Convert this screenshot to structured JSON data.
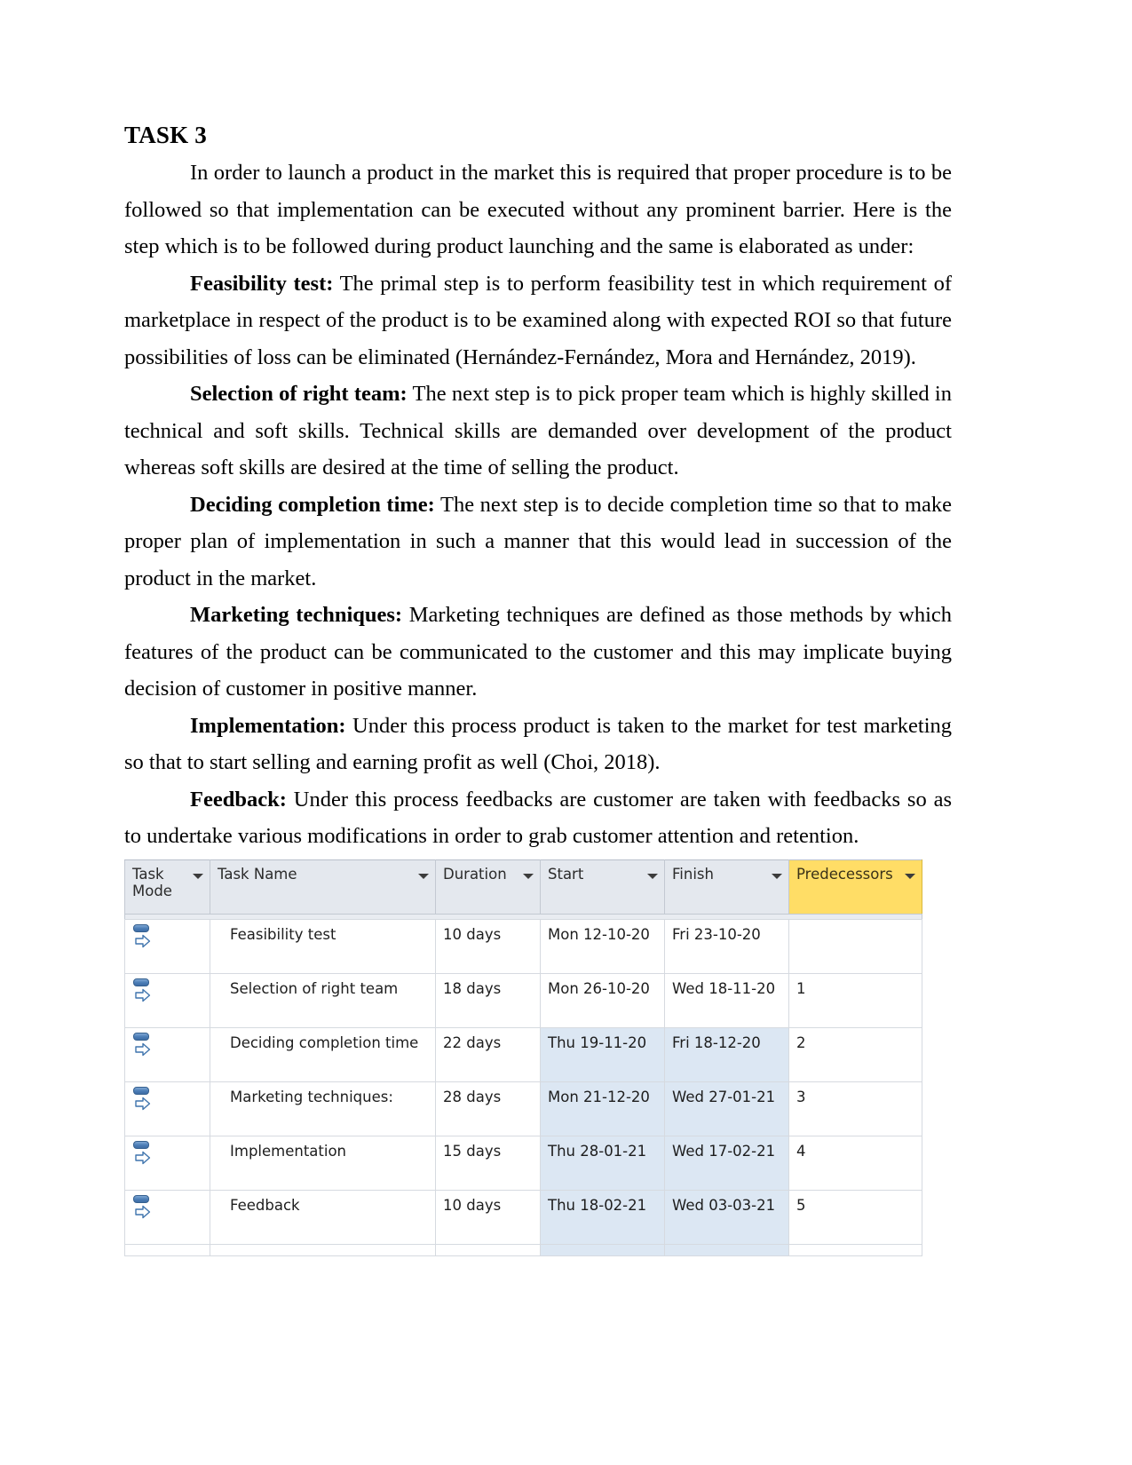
{
  "document": {
    "title": "TASK 3",
    "paragraphs": [
      {
        "lead": "",
        "text": "In order to launch a product in the market this is required that proper procedure is to be followed so that implementation can be executed without any prominent barrier. Here is the step which is to be followed during product launching and the same is elaborated as under:"
      },
      {
        "lead": "Feasibility test:",
        "text": " The primal step is to perform feasibility test in which requirement of marketplace in respect of the product is to be examined along with expected ROI so that future possibilities of loss can be eliminated (Hernández-Fernández, Mora and Hernández, 2019)."
      },
      {
        "lead": "Selection of right team:",
        "text": " The next step is to pick proper team which is highly skilled in technical and soft skills. Technical skills are demanded over development of the product whereas soft skills are desired at the time of selling the product."
      },
      {
        "lead": "Deciding completion time:",
        "text": " The next step is to decide completion time so that to make proper plan of implementation in such a manner that this would lead in succession of the product in the market."
      },
      {
        "lead": "Marketing techniques:",
        "text": " Marketing techniques are defined as those methods by which features of the product can be communicated to the customer and this may implicate buying decision of customer in positive manner."
      },
      {
        "lead": "Implementation:",
        "text": " Under this process product is taken to the market for test marketing so that to start selling and earning profit as well (Choi, 2018)."
      },
      {
        "lead": "Feedback:",
        "text": " Under this process feedbacks are customer are taken with feedbacks so as to undertake various modifications in order to grab customer attention and retention."
      }
    ]
  },
  "project_table": {
    "columns": [
      {
        "label": "Task Mode",
        "has_filter": true,
        "highlight": false
      },
      {
        "label": "Task Name",
        "has_filter": true,
        "highlight": false
      },
      {
        "label": "Duration",
        "has_filter": true,
        "highlight": false
      },
      {
        "label": "Start",
        "has_filter": true,
        "highlight": false
      },
      {
        "label": "Finish",
        "has_filter": true,
        "highlight": false
      },
      {
        "label": "Predecessors",
        "has_filter": true,
        "highlight": true
      }
    ],
    "highlight_color": "#ffdd66",
    "selection_color": "#dce7f3",
    "task_mode_icon": "auto-scheduled-icon",
    "rows": [
      {
        "mode": "auto-scheduled-icon",
        "name": "Feasibility test",
        "duration": "10 days",
        "start": "Mon 12-10-20",
        "finish": "Fri 23-10-20",
        "predecessors": "",
        "selected": false
      },
      {
        "mode": "auto-scheduled-icon",
        "name": "Selection of right team",
        "duration": "18 days",
        "start": "Mon 26-10-20",
        "finish": "Wed 18-11-20",
        "predecessors": "1",
        "selected": false
      },
      {
        "mode": "auto-scheduled-icon",
        "name": "Deciding completion time",
        "duration": "22 days",
        "start": "Thu 19-11-20",
        "finish": "Fri 18-12-20",
        "predecessors": "2",
        "selected": true
      },
      {
        "mode": "auto-scheduled-icon",
        "name": "Marketing techniques:",
        "duration": "28 days",
        "start": "Mon 21-12-20",
        "finish": "Wed 27-01-21",
        "predecessors": "3",
        "selected": true
      },
      {
        "mode": "auto-scheduled-icon",
        "name": "Implementation",
        "duration": "15 days",
        "start": "Thu 28-01-21",
        "finish": "Wed 17-02-21",
        "predecessors": "4",
        "selected": true
      },
      {
        "mode": "auto-scheduled-icon",
        "name": "Feedback",
        "duration": "10 days",
        "start": "Thu 18-02-21",
        "finish": "Wed 03-03-21",
        "predecessors": "5",
        "selected": true
      }
    ]
  }
}
